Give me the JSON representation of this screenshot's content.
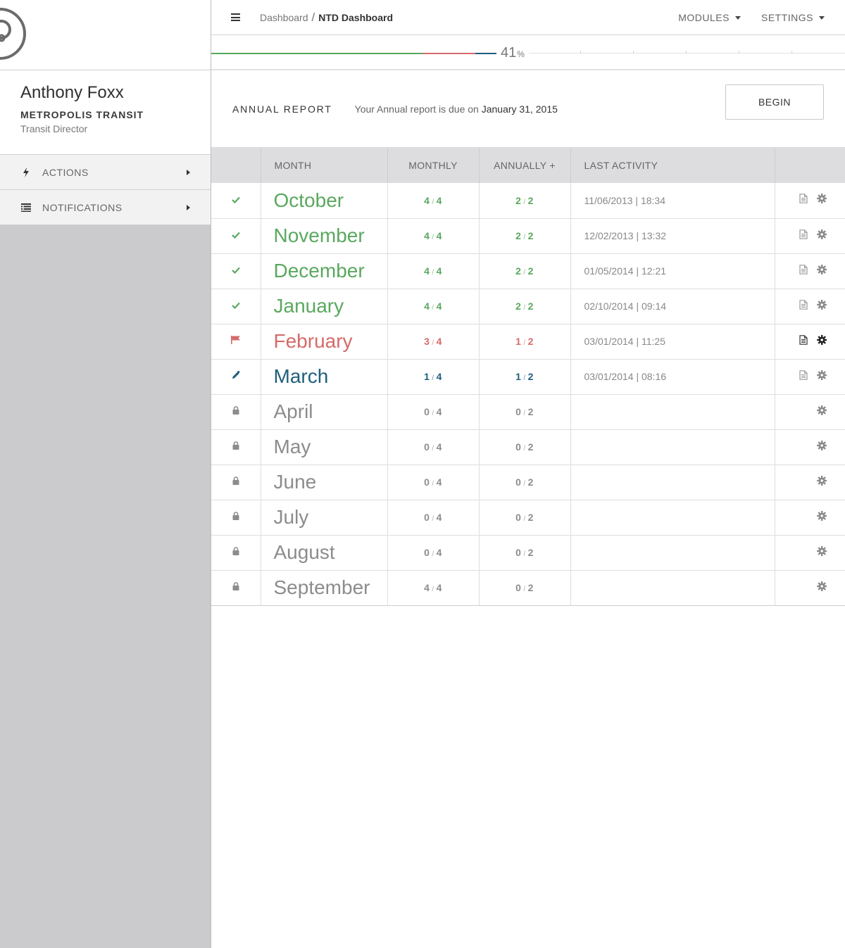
{
  "colors": {
    "complete": "#5aa85f",
    "flagged": "#d66a6a",
    "editing": "#1e5f7d",
    "locked": "#8c8c8c",
    "sidebar_bg": "#cbcbcd"
  },
  "profile": {
    "name": "Anthony Foxx",
    "organization": "METROPOLIS TRANSIT",
    "role": "Transit Director"
  },
  "sidebar": {
    "items": [
      {
        "label": "ACTIONS",
        "icon": "bolt-icon"
      },
      {
        "label": "NOTIFICATIONS",
        "icon": "list-icon"
      }
    ]
  },
  "header": {
    "breadcrumb": {
      "root": "Dashboard",
      "separator": "/",
      "current": "NTD Dashboard"
    },
    "menu": {
      "modules": "MODULES",
      "settings": "SETTINGS"
    }
  },
  "progress": {
    "value": "41",
    "unit": "%",
    "segments": [
      {
        "status": "complete",
        "fraction": 0.333
      },
      {
        "status": "flagged",
        "fraction": 0.083
      },
      {
        "status": "editing",
        "fraction": 0.033
      }
    ]
  },
  "report": {
    "title": "ANNUAL REPORT",
    "due_text": "Your Annual report is due on",
    "due_date": "January 31, 2015",
    "begin_label": "BEGIN"
  },
  "table": {
    "headers": {
      "month": "MONTH",
      "monthly": "MONTHLY",
      "annually": "ANNUALLY +",
      "last_activity": "LAST ACTIVITY"
    },
    "rows": [
      {
        "month": "October",
        "status": "complete",
        "monthly_done": "4",
        "monthly_total": "4",
        "annual_done": "2",
        "annual_total": "2",
        "activity": "11/06/2013 | 18:34",
        "has_doc": true
      },
      {
        "month": "November",
        "status": "complete",
        "monthly_done": "4",
        "monthly_total": "4",
        "annual_done": "2",
        "annual_total": "2",
        "activity": "12/02/2013 | 13:32",
        "has_doc": true
      },
      {
        "month": "December",
        "status": "complete",
        "monthly_done": "4",
        "monthly_total": "4",
        "annual_done": "2",
        "annual_total": "2",
        "activity": "01/05/2014 | 12:21",
        "has_doc": true
      },
      {
        "month": "January",
        "status": "complete",
        "monthly_done": "4",
        "monthly_total": "4",
        "annual_done": "2",
        "annual_total": "2",
        "activity": "02/10/2014 | 09:14",
        "has_doc": true
      },
      {
        "month": "February",
        "status": "flagged",
        "monthly_done": "3",
        "monthly_total": "4",
        "annual_done": "1",
        "annual_total": "2",
        "activity": "03/01/2014 | 11:25",
        "has_doc": true
      },
      {
        "month": "March",
        "status": "editing",
        "monthly_done": "1",
        "monthly_total": "4",
        "annual_done": "1",
        "annual_total": "2",
        "activity": "03/01/2014 | 08:16",
        "has_doc": true
      },
      {
        "month": "April",
        "status": "locked",
        "monthly_done": "0",
        "monthly_total": "4",
        "annual_done": "0",
        "annual_total": "2",
        "activity": "",
        "has_doc": false
      },
      {
        "month": "May",
        "status": "locked",
        "monthly_done": "0",
        "monthly_total": "4",
        "annual_done": "0",
        "annual_total": "2",
        "activity": "",
        "has_doc": false
      },
      {
        "month": "June",
        "status": "locked",
        "monthly_done": "0",
        "monthly_total": "4",
        "annual_done": "0",
        "annual_total": "2",
        "activity": "",
        "has_doc": false
      },
      {
        "month": "July",
        "status": "locked",
        "monthly_done": "0",
        "monthly_total": "4",
        "annual_done": "0",
        "annual_total": "2",
        "activity": "",
        "has_doc": false
      },
      {
        "month": "August",
        "status": "locked",
        "monthly_done": "0",
        "monthly_total": "4",
        "annual_done": "0",
        "annual_total": "2",
        "activity": "",
        "has_doc": false
      },
      {
        "month": "September",
        "status": "locked",
        "monthly_done": "4",
        "monthly_total": "4",
        "annual_done": "0",
        "annual_total": "2",
        "activity": "",
        "has_doc": false
      }
    ]
  }
}
